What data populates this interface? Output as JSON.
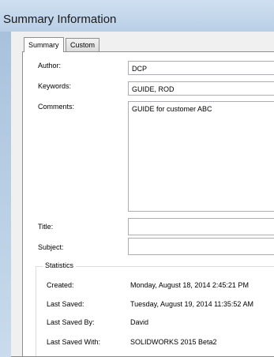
{
  "window": {
    "title": "Summary Information"
  },
  "tabs": [
    {
      "label": "Summary",
      "active": true
    },
    {
      "label": "Custom",
      "active": false
    }
  ],
  "fields": {
    "author": {
      "label": "Author:",
      "value": "DCP"
    },
    "keywords": {
      "label": "Keywords:",
      "value": "GUIDE, ROD"
    },
    "comments": {
      "label": "Comments:",
      "value": "GUIDE for customer ABC"
    },
    "title": {
      "label": "Title:",
      "value": ""
    },
    "subject": {
      "label": "Subject:",
      "value": ""
    }
  },
  "statistics": {
    "title": "Statistics",
    "rows": [
      {
        "label": "Created:",
        "value": "Monday, August 18, 2014 2:45:21 PM"
      },
      {
        "label": "Last Saved:",
        "value": "Tuesday, August 19, 2014 11:35:52 AM"
      },
      {
        "label": "Last Saved By:",
        "value": "David"
      },
      {
        "label": "Last Saved With:",
        "value": "SOLIDWORKS 2015 Beta2"
      }
    ]
  }
}
